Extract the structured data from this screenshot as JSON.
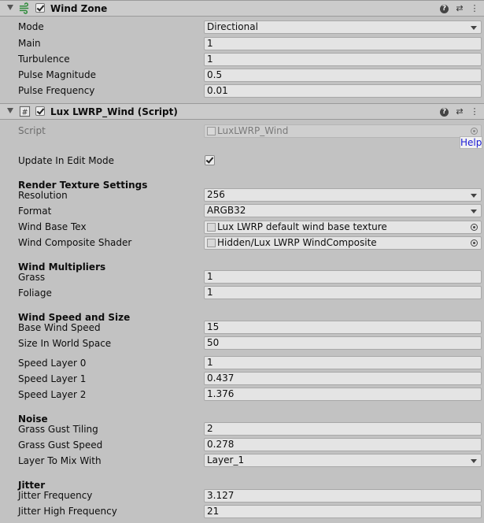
{
  "wind_zone": {
    "title": "Wind Zone",
    "rows": [
      {
        "label": "Mode",
        "value": "Directional",
        "kind": "dropdown"
      },
      {
        "label": "Main",
        "value": "1"
      },
      {
        "label": "Turbulence",
        "value": "1"
      },
      {
        "label": "Pulse Magnitude",
        "value": "0.5"
      },
      {
        "label": "Pulse Frequency",
        "value": "0.01"
      }
    ]
  },
  "lux_wind": {
    "title": "Lux LWRP_Wind (Script)",
    "script_label": "Script",
    "script_value": "LuxLWRP_Wind",
    "help_label": "Help",
    "update_in_edit_mode_label": "Update In Edit Mode",
    "sections": {
      "render_texture": "Render Texture Settings",
      "wind_multipliers": "Wind Multipliers",
      "wind_speed": "Wind Speed and Size",
      "noise": "Noise",
      "jitter": "Jitter"
    },
    "rows": {
      "resolution": {
        "label": "Resolution",
        "value": "256"
      },
      "format": {
        "label": "Format",
        "value": "ARGB32"
      },
      "wind_base_tex": {
        "label": "Wind Base Tex",
        "value": "Lux LWRP default wind base texture"
      },
      "wind_composite_shader": {
        "label": "Wind Composite Shader",
        "value": "Hidden/Lux LWRP WindComposite"
      },
      "grass": {
        "label": "Grass",
        "value": "1"
      },
      "foliage": {
        "label": "Foliage",
        "value": "1"
      },
      "base_wind_speed": {
        "label": "Base Wind Speed",
        "value": "15"
      },
      "size_in_world_space": {
        "label": "Size In World Space",
        "value": "50"
      },
      "speed_layer_0": {
        "label": "Speed Layer 0",
        "value": "1"
      },
      "speed_layer_1": {
        "label": "Speed Layer 1",
        "value": "0.437"
      },
      "speed_layer_2": {
        "label": "Speed Layer 2",
        "value": "1.376"
      },
      "grass_gust_tiling": {
        "label": "Grass Gust Tiling",
        "value": "2"
      },
      "grass_gust_speed": {
        "label": "Grass Gust Speed",
        "value": "0.278"
      },
      "layer_to_mix_with": {
        "label": "Layer To Mix With",
        "value": "Layer_1"
      },
      "jitter_frequency": {
        "label": "Jitter Frequency",
        "value": "3.127"
      },
      "jitter_high_frequency": {
        "label": "Jitter High Frequency",
        "value": "21"
      }
    }
  },
  "icons": {
    "help": "?",
    "presets": "⇄",
    "menu": "⋮"
  }
}
